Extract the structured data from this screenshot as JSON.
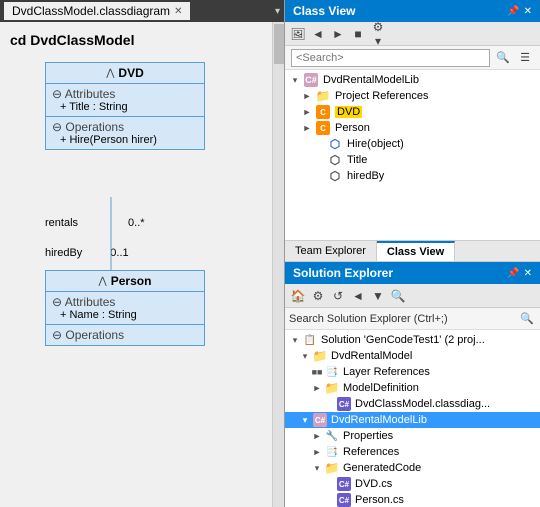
{
  "leftPanel": {
    "tabName": "DvdClassModel.classdiagram",
    "diagramLabel": "cd DvdClassModel",
    "dvdClass": {
      "name": "DVD",
      "attributes": {
        "title": "Attributes",
        "items": [
          "+ Title : String"
        ]
      },
      "operations": {
        "title": "Operations",
        "items": [
          "+ Hire(Person hirer)"
        ]
      }
    },
    "personClass": {
      "name": "Person",
      "attributes": {
        "title": "Attributes",
        "items": [
          "+ Name : String"
        ]
      },
      "operations": {
        "title": "Operations",
        "items": []
      }
    },
    "connectorRentals": {
      "label": "rentals",
      "multiplicity": "0..*"
    },
    "connectorHiredBy": {
      "label": "hiredBy",
      "multiplicity": "0..1"
    }
  },
  "classView": {
    "title": "Class View",
    "searchPlaceholder": "<Search>",
    "toolbar": {
      "backLabel": "◄",
      "forwardLabel": "►",
      "stopLabel": "■",
      "settingsLabel": "⚙"
    },
    "tree": [
      {
        "id": "dvdrentalmodellib",
        "label": "DvdRentalModelLib",
        "type": "lib",
        "indent": 0,
        "expanded": true,
        "arrow": "▾"
      },
      {
        "id": "projectrefs",
        "label": "Project References",
        "type": "folder",
        "indent": 1,
        "expanded": false,
        "arrow": "►"
      },
      {
        "id": "dvd",
        "label": "DVD",
        "type": "class-orange",
        "indent": 1,
        "expanded": false,
        "arrow": "►",
        "highlighted": true
      },
      {
        "id": "person",
        "label": "Person",
        "type": "class-orange",
        "indent": 1,
        "expanded": false,
        "arrow": "►"
      },
      {
        "id": "hireobject",
        "label": "Hire(object)",
        "type": "method",
        "indent": 2,
        "expanded": false,
        "arrow": ""
      },
      {
        "id": "title-prop",
        "label": "Title",
        "type": "prop",
        "indent": 2,
        "expanded": false,
        "arrow": ""
      },
      {
        "id": "hiredby-prop",
        "label": "hiredBy",
        "type": "prop",
        "indent": 2,
        "expanded": false,
        "arrow": ""
      }
    ],
    "tabs": [
      "Team Explorer",
      "Class View"
    ]
  },
  "solutionExplorer": {
    "title": "Solution Explorer",
    "searchLabel": "Search Solution Explorer (Ctrl+;)",
    "tree": [
      {
        "id": "solution",
        "label": "Solution 'GenCodeTest1' (2 proj...",
        "type": "solution",
        "indent": 0,
        "arrow": "▾"
      },
      {
        "id": "dvdrentalmodel",
        "label": "DvdRentalModel",
        "type": "folder",
        "indent": 1,
        "arrow": "▾"
      },
      {
        "id": "layerrefs",
        "label": "Layer References",
        "type": "refs",
        "indent": 2,
        "arrow": "■■"
      },
      {
        "id": "modeldefinition",
        "label": "ModelDefinition",
        "type": "folder-img",
        "indent": 2,
        "arrow": "►"
      },
      {
        "id": "dvdclassdiag",
        "label": "DvdClassModel.classdiag...",
        "type": "cs-file",
        "indent": 3,
        "arrow": ""
      },
      {
        "id": "dvdrentalmodellibActive",
        "label": "DvdRentalModelLib",
        "type": "lib-active",
        "indent": 1,
        "arrow": "▾",
        "active": true
      },
      {
        "id": "properties",
        "label": "Properties",
        "type": "folder",
        "indent": 2,
        "arrow": "►"
      },
      {
        "id": "references",
        "label": "References",
        "type": "refs2",
        "indent": 2,
        "arrow": "►"
      },
      {
        "id": "generatedcode",
        "label": "GeneratedCode",
        "type": "folder",
        "indent": 2,
        "arrow": "▾"
      },
      {
        "id": "dvd-cs",
        "label": "DVD.cs",
        "type": "cs-class",
        "indent": 3,
        "arrow": ""
      },
      {
        "id": "person-cs",
        "label": "Person.cs",
        "type": "cs-class",
        "indent": 3,
        "arrow": ""
      }
    ]
  }
}
